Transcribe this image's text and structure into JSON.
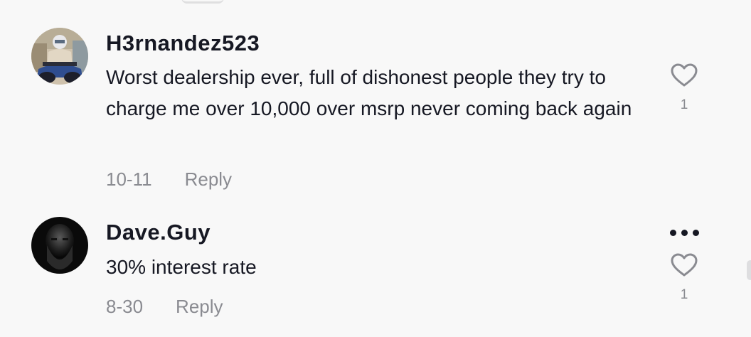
{
  "comments": [
    {
      "username": "H3rnandez523",
      "text": "Worst dealership ever, full of dishonest people they try to charge me over 10,000 over msrp never coming back again",
      "date": "10-11",
      "reply_label": "Reply",
      "likes": "1",
      "avatar_icon": "avatar-photo-atv-rider"
    },
    {
      "username": "Dave.Guy",
      "text": "30% interest rate",
      "date": "8-30",
      "reply_label": "Reply",
      "likes": "1",
      "avatar_icon": "avatar-photo-bearded-man",
      "more_icon": "more-options-icon"
    }
  ]
}
